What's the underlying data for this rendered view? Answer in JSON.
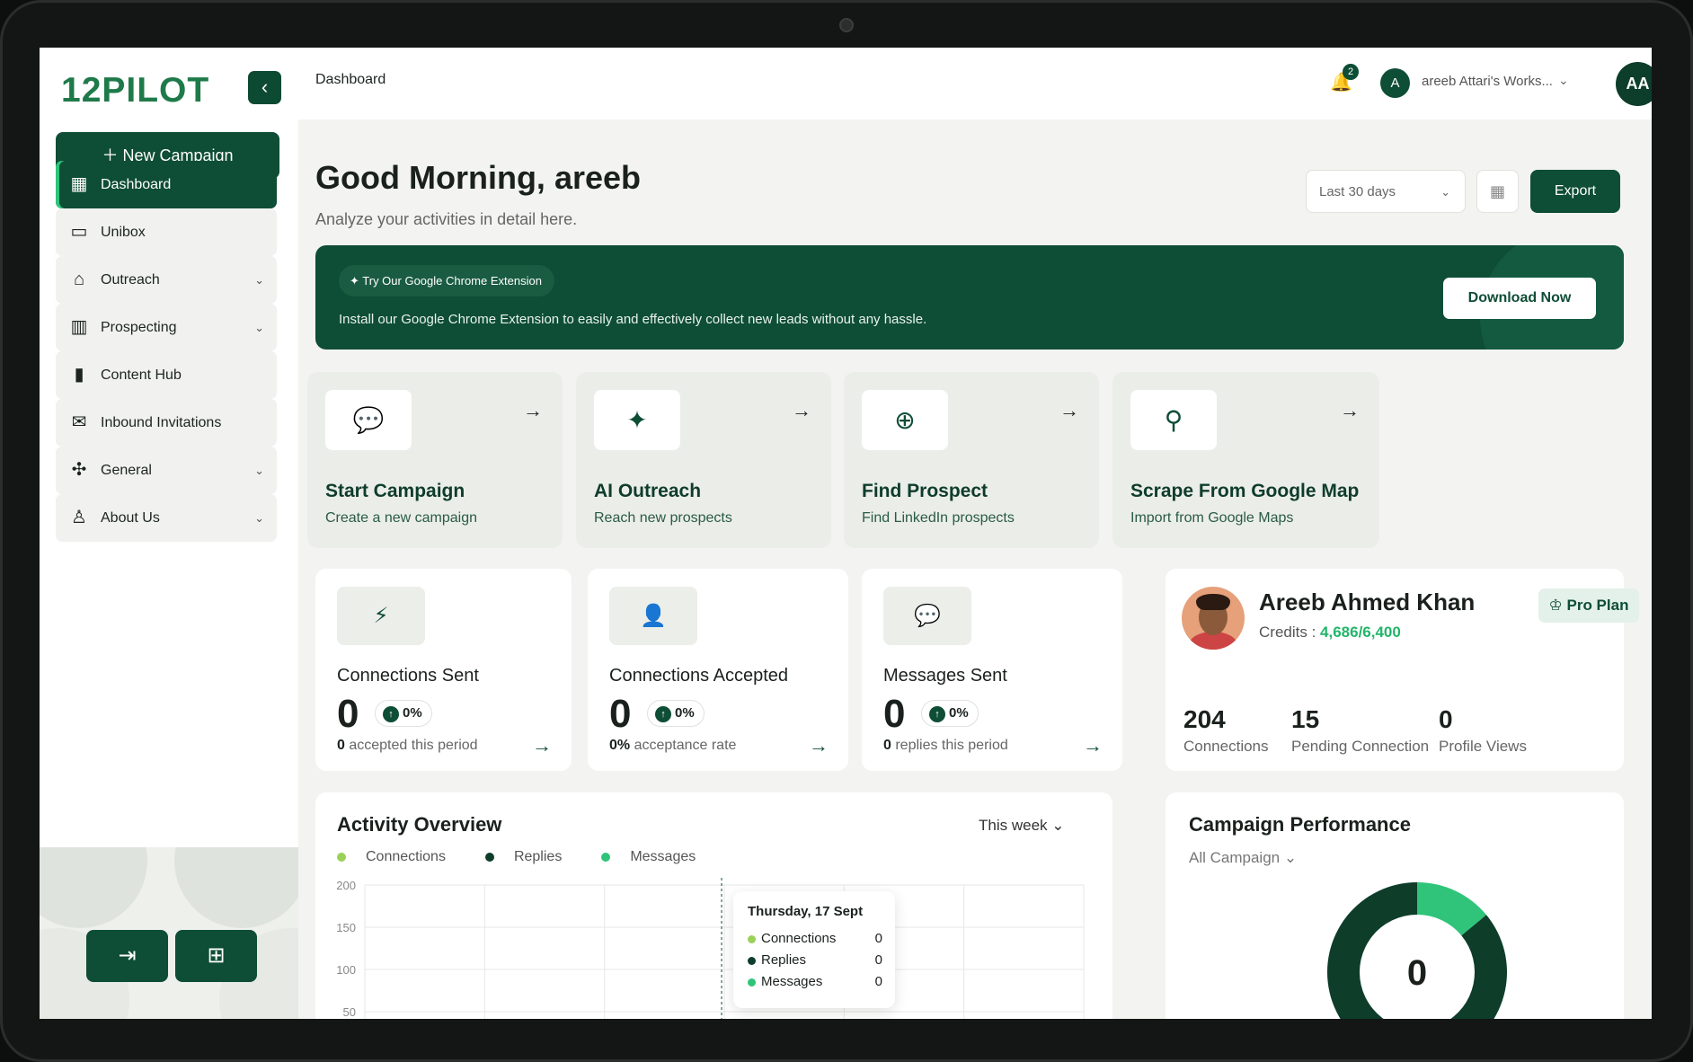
{
  "brand": {
    "logo_text": "12PILOT",
    "collapse_icon": "chevron-left-icon"
  },
  "sidebar": {
    "new_campaign": "New Campaign",
    "items": [
      {
        "label": "Dashboard",
        "icon": "grid-icon",
        "active": true,
        "chevron": false
      },
      {
        "label": "Unibox",
        "icon": "inbox-icon",
        "active": false,
        "chevron": false
      },
      {
        "label": "Outreach",
        "icon": "outreach-icon",
        "active": false,
        "chevron": true
      },
      {
        "label": "Prospecting",
        "icon": "bar-chart-icon",
        "active": false,
        "chevron": true
      },
      {
        "label": "Content Hub",
        "icon": "document-icon",
        "active": false,
        "chevron": false
      },
      {
        "label": "Inbound Invitations",
        "icon": "invite-icon",
        "active": false,
        "chevron": false
      },
      {
        "label": "General",
        "icon": "network-icon",
        "active": false,
        "chevron": true
      },
      {
        "label": "About Us",
        "icon": "user-icon",
        "active": false,
        "chevron": true
      }
    ]
  },
  "topbar": {
    "breadcrumb": "Dashboard",
    "notification_count": "2",
    "workspace_initial": "A",
    "workspace_name": "areeb Attari's Works...",
    "user_initials": "AA"
  },
  "header": {
    "greeting": "Good Morning, areeb",
    "subtitle": "Analyze your activities in detail here.",
    "range_value": "Last 30 days",
    "export": "Export"
  },
  "banner": {
    "pill": "Try Our Google Chrome Extension",
    "text": "Install our Google Chrome Extension to easily and effectively collect new leads without any hassle.",
    "button": "Download Now"
  },
  "quick_actions": [
    {
      "title": "Start Campaign",
      "subtitle": "Create a new campaign",
      "icon": "chat-icon"
    },
    {
      "title": "AI Outreach",
      "subtitle": "Reach new prospects",
      "icon": "sparkle-icon"
    },
    {
      "title": "Find Prospect",
      "subtitle": "Find LinkedIn prospects",
      "icon": "plus-circle-icon"
    },
    {
      "title": "Scrape From Google Map",
      "subtitle": "Import from Google Maps",
      "icon": "map-pin-icon"
    }
  ],
  "stats": [
    {
      "title": "Connections Sent",
      "value": "0",
      "pct": "0%",
      "foot_bold": "0",
      "foot": " accepted this period",
      "icon": "plug-icon"
    },
    {
      "title": "Connections Accepted",
      "value": "0",
      "pct": "0%",
      "foot_bold": "0%",
      "foot": " acceptance rate",
      "icon": "user-check-icon"
    },
    {
      "title": "Messages Sent",
      "value": "0",
      "pct": "0%",
      "foot_bold": "0",
      "foot": " replies this period",
      "icon": "message-icon"
    }
  ],
  "profile": {
    "name": "Areeb Ahmed Khan",
    "credits_label": "Credits : ",
    "credits_value": "4,686/6,400",
    "plan": "Pro Plan",
    "stats": [
      {
        "value": "204",
        "label": "Connections"
      },
      {
        "value": "15",
        "label": "Pending Connection"
      },
      {
        "value": "0",
        "label": "Profile Views"
      }
    ]
  },
  "activity": {
    "title": "Activity Overview",
    "period": "This week",
    "legend": [
      {
        "name": "Connections",
        "color": "#9bd15a"
      },
      {
        "name": "Replies",
        "color": "#0e3d2a"
      },
      {
        "name": "Messages",
        "color": "#2fc47a"
      }
    ],
    "y_ticks": [
      "200",
      "150",
      "100",
      "50"
    ],
    "tooltip": {
      "date": "Thursday, 17 Sept",
      "rows": [
        {
          "name": "Connections",
          "value": "0"
        },
        {
          "name": "Replies",
          "value": "0"
        },
        {
          "name": "Messages",
          "value": "0"
        }
      ]
    }
  },
  "performance": {
    "title": "Campaign Performance",
    "filter": "All Campaign",
    "center_value": "0",
    "segments": [
      {
        "share": 0.14,
        "color": "#2fc47a"
      },
      {
        "share": 0.86,
        "color": "#0e3d2a"
      }
    ]
  }
}
